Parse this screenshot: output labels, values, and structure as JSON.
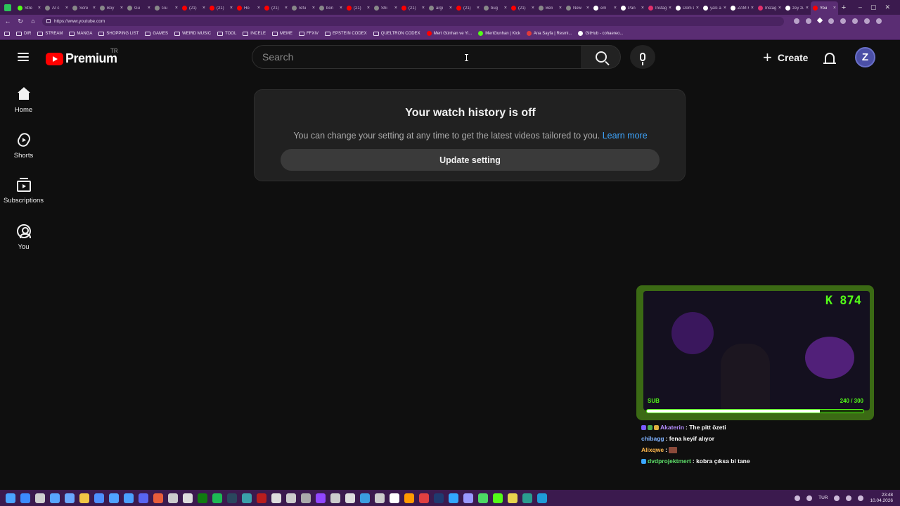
{
  "browser": {
    "tabs": [
      {
        "label": "Stre",
        "color": "#53fc18",
        "active": false
      },
      {
        "label": "AI c",
        "color": "#888888",
        "active": false
      },
      {
        "label": "Scre",
        "color": "#888888",
        "active": false
      },
      {
        "label": "Boy",
        "color": "#888888",
        "active": false
      },
      {
        "label": "Gu",
        "color": "#888888",
        "active": false
      },
      {
        "label": "Gu",
        "color": "#888888",
        "active": false
      },
      {
        "label": "(21)",
        "color": "#ff0000",
        "active": false
      },
      {
        "label": "(21)",
        "color": "#ff0000",
        "active": false
      },
      {
        "label": "Ho",
        "color": "#ff0000",
        "active": false
      },
      {
        "label": "(21)",
        "color": "#ff0000",
        "active": false
      },
      {
        "label": "refu",
        "color": "#888888",
        "active": false
      },
      {
        "label": "bon",
        "color": "#888888",
        "active": false
      },
      {
        "label": "(21)",
        "color": "#ff0000",
        "active": false
      },
      {
        "label": "Shi",
        "color": "#888888",
        "active": false
      },
      {
        "label": "(21)",
        "color": "#ff0000",
        "active": false
      },
      {
        "label": "argi",
        "color": "#888888",
        "active": false
      },
      {
        "label": "(21)",
        "color": "#ff0000",
        "active": false
      },
      {
        "label": "bug",
        "color": "#888888",
        "active": false
      },
      {
        "label": "(21)",
        "color": "#ff0000",
        "active": false
      },
      {
        "label": "Beli",
        "color": "#888888",
        "active": false
      },
      {
        "label": "New",
        "color": "#888888",
        "active": false
      },
      {
        "label": "em",
        "color": "#ffffff",
        "active": false
      },
      {
        "label": "Pan",
        "color": "#ffffff",
        "active": false
      },
      {
        "label": "Instagr",
        "color": "#e1306c",
        "active": false
      },
      {
        "label": "Dom Lo",
        "color": "#ffffff",
        "active": false
      },
      {
        "label": "yalc ar",
        "color": "#ffffff",
        "active": false
      },
      {
        "label": "ZAM Ho",
        "color": "#ffffff",
        "active": false
      },
      {
        "label": "Instagr",
        "color": "#e1306c",
        "active": false
      },
      {
        "label": "zey zu",
        "color": "#ffffff",
        "active": false
      },
      {
        "label": "You",
        "color": "#ff0000",
        "active": true
      }
    ],
    "new_tab": "+",
    "win_controls": [
      "–",
      "▢",
      "✕"
    ],
    "url": "https://www.youtube.com",
    "bookmarks": [
      {
        "label": "DIR",
        "type": "folder"
      },
      {
        "label": "STREAM",
        "type": "folder"
      },
      {
        "label": "MANGA",
        "type": "folder"
      },
      {
        "label": "SHOPPING LIST",
        "type": "folder"
      },
      {
        "label": "GAMES",
        "type": "folder"
      },
      {
        "label": "WEIRD MUSIC",
        "type": "folder"
      },
      {
        "label": "TOOL",
        "type": "folder"
      },
      {
        "label": "INCELE",
        "type": "folder"
      },
      {
        "label": "MEME",
        "type": "folder"
      },
      {
        "label": "FFXIV",
        "type": "folder"
      },
      {
        "label": "EPSTEIN CODEX",
        "type": "folder"
      },
      {
        "label": "QUELTRON CODEX",
        "type": "folder"
      },
      {
        "label": "Mert Günhan ve Yi...",
        "type": "site",
        "color": "#ff0000"
      },
      {
        "label": "MertGunhan | Kick",
        "type": "site",
        "color": "#53fc18"
      },
      {
        "label": "Ana Sayfa | Resmi...",
        "type": "site",
        "color": "#e03a3a"
      },
      {
        "label": "GitHub - cohaereo...",
        "type": "site",
        "color": "#ffffff"
      }
    ]
  },
  "yt": {
    "logo_word": "Premium",
    "country_code": "TR",
    "search_placeholder": "Search",
    "create_label": "Create",
    "avatar_letter": "Z",
    "sidebar": [
      {
        "label": "Home",
        "icon": "home-icon"
      },
      {
        "label": "Shorts",
        "icon": "shorts-icon"
      },
      {
        "label": "Subscriptions",
        "icon": "subscriptions-icon"
      },
      {
        "label": "You",
        "icon": "you-icon"
      }
    ],
    "history": {
      "title": "Your watch history is off",
      "message": "You can change your setting at any time to get the latest videos tailored to you.",
      "link": "Learn more",
      "button": "Update setting"
    }
  },
  "overlay": {
    "viewers": "K 874",
    "sub_label": "SUB",
    "sub_count": "240 / 300",
    "sub_progress": 0.8,
    "accent": "#53fc18",
    "chat": [
      {
        "user": "Akaterin",
        "user_color": "#b48cff",
        "text": ": The pitt özeti",
        "badges": [
          "#7a5cff",
          "#4caf50",
          "#e0b040"
        ]
      },
      {
        "user": "chibagg",
        "user_color": "#7fb2ff",
        "text": ": fena keyif alıyor",
        "badges": []
      },
      {
        "user": "Alixqwe",
        "user_color": "#ffb84d",
        "text": ":",
        "badges": [],
        "emote": true
      },
      {
        "user": "dvdprojektmert",
        "user_color": "#5ee06a",
        "text": ": kobra çıksa bi tane",
        "badges": [
          "#3aa7ff"
        ]
      }
    ]
  },
  "taskbar": {
    "icons": [
      "#3b8bff",
      "#cfcfcf",
      "#58a6ff",
      "#6aa8ff",
      "#f2c744",
      "#4d8fff",
      "#4fa2ff",
      "#4aa0ff",
      "#5865f2",
      "#e85d3a",
      "#cccccc",
      "#dddddd",
      "#107c10",
      "#1db954",
      "#2a475e",
      "#3aa0aa",
      "#b91d1d",
      "#dddddd",
      "#cccccc",
      "#aaaaaa",
      "#9146ff",
      "#cccccc",
      "#dddddd",
      "#3a9ee0",
      "#cccccc",
      "#ffffff",
      "#ff9a00",
      "#e04040",
      "#1f3a70",
      "#31a8ff",
      "#9999ff",
      "#4cd964",
      "#53fc18",
      "#e8d44d",
      "#2a9d8f",
      "#1e9bd7"
    ],
    "lang": "TUR",
    "time": "23:48",
    "date": "10.04.2026"
  }
}
